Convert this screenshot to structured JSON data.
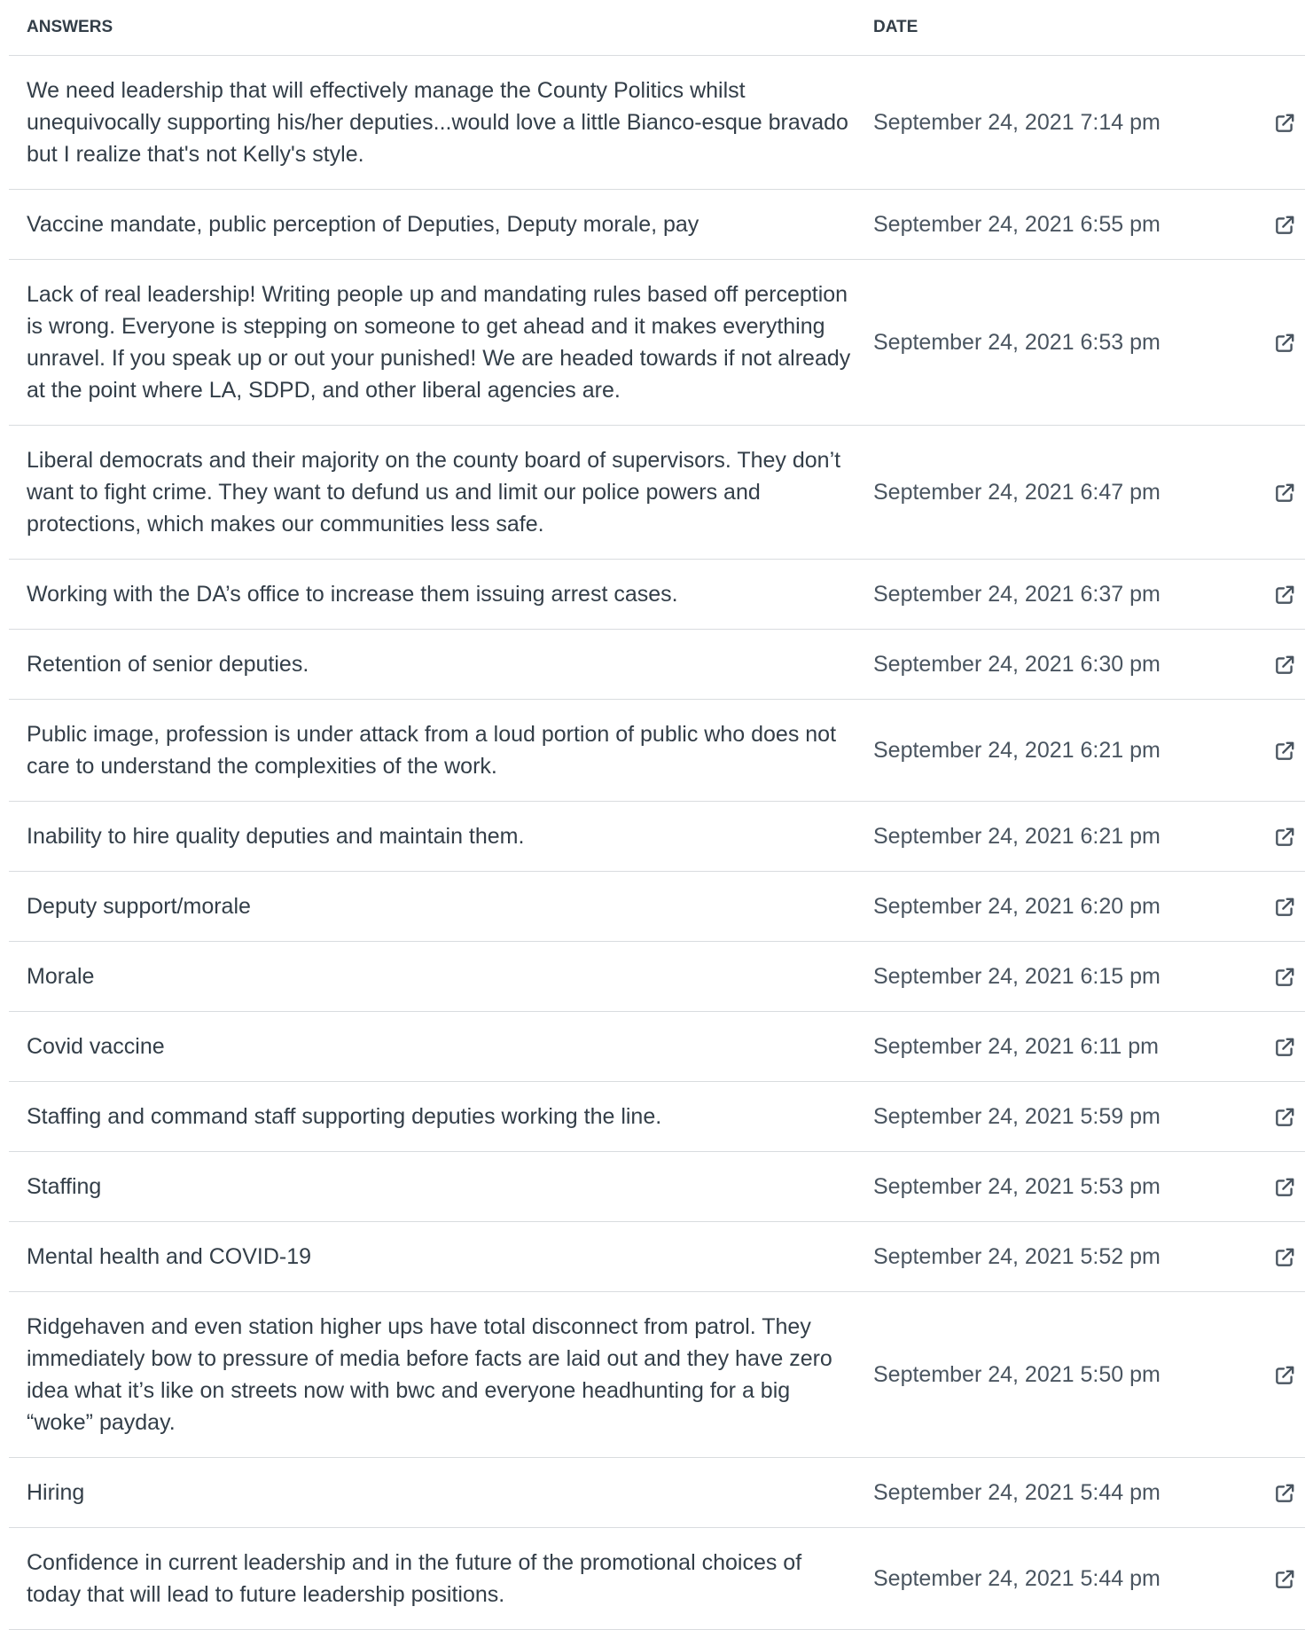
{
  "table": {
    "headers": {
      "answers": "ANSWERS",
      "date": "DATE"
    },
    "link_icon": "external-link-icon",
    "rows": [
      {
        "answer": "We need leadership that will effectively manage the County Politics whilst unequivocally supporting his/her deputies...would love a little Bianco-esque bravado but I realize that's not Kelly's style.",
        "date": "September 24, 2021 7:14 pm"
      },
      {
        "answer": "Vaccine mandate, public perception of Deputies, Deputy morale, pay",
        "date": "September 24, 2021 6:55 pm"
      },
      {
        "answer": "Lack of real leadership! Writing people up and mandating rules based off perception is wrong. Everyone is stepping on someone to get ahead and it makes everything unravel. If you speak up or out your punished! We are headed towards if not already at the point where LA, SDPD, and other liberal agencies are.",
        "date": "September 24, 2021 6:53 pm"
      },
      {
        "answer": "Liberal democrats and their majority on the county board of supervisors. They don’t want to fight crime. They want to defund us and limit our police powers and protections, which makes our communities less safe.",
        "date": "September 24, 2021 6:47 pm"
      },
      {
        "answer": "Working with the DA’s office to increase them issuing arrest cases.",
        "date": "September 24, 2021 6:37 pm"
      },
      {
        "answer": "Retention of senior deputies.",
        "date": "September 24, 2021 6:30 pm"
      },
      {
        "answer": "Public image, profession is under attack from a loud portion of public who does not care to understand the complexities of the work.",
        "date": "September 24, 2021 6:21 pm"
      },
      {
        "answer": "Inability to hire quality deputies and maintain them.",
        "date": "September 24, 2021 6:21 pm"
      },
      {
        "answer": "Deputy support/morale",
        "date": "September 24, 2021 6:20 pm"
      },
      {
        "answer": "Morale",
        "date": "September 24, 2021 6:15 pm"
      },
      {
        "answer": "Covid vaccine",
        "date": "September 24, 2021 6:11 pm"
      },
      {
        "answer": "Staffing and command staff supporting deputies working the line.",
        "date": "September 24, 2021 5:59 pm"
      },
      {
        "answer": "Staffing",
        "date": "September 24, 2021 5:53 pm"
      },
      {
        "answer": "Mental health and COVID-19",
        "date": "September 24, 2021 5:52 pm"
      },
      {
        "answer": "Ridgehaven and even station higher ups have total disconnect from patrol. They immediately bow to pressure of media before facts are laid out and they have zero idea what it’s like on streets now with bwc and everyone headhunting for a big “woke” payday.",
        "date": "September 24, 2021 5:50 pm"
      },
      {
        "answer": "Hiring",
        "date": "September 24, 2021 5:44 pm"
      },
      {
        "answer": "Confidence in current leadership and in the future of the promotional choices of today that will lead to future leadership positions.",
        "date": "September 24, 2021 5:44 pm"
      }
    ]
  }
}
